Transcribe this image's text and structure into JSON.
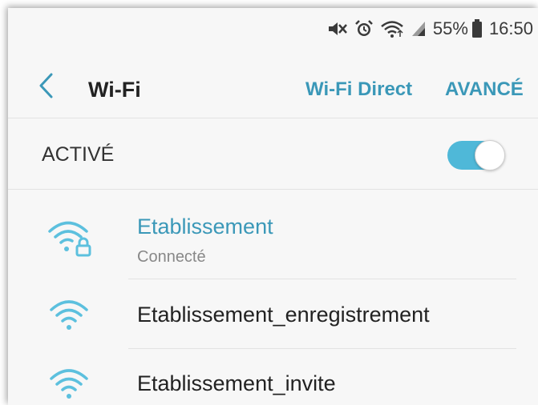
{
  "status_bar": {
    "icons": [
      "mute-vibrate-icon",
      "alarm-icon",
      "wifi-signal-icon",
      "cell-signal-icon",
      "battery-icon"
    ],
    "battery_percent": "55%",
    "time": "16:50"
  },
  "action_bar": {
    "back_icon": "chevron-left-icon",
    "title": "Wi-Fi",
    "wifi_direct_label": "Wi-Fi Direct",
    "advanced_label": "AVANCÉ"
  },
  "master_switch": {
    "label": "ACTIVÉ",
    "state": "on"
  },
  "networks": [
    {
      "name": "Etablissement",
      "status": "Connecté",
      "secured": true,
      "connected": true
    },
    {
      "name": "Etablissement_enregistrement",
      "status": "",
      "secured": false,
      "connected": false
    },
    {
      "name": "Etablissement_invite",
      "status": "",
      "secured": false,
      "connected": false
    }
  ],
  "colors": {
    "accent": "#3b98b8",
    "toggle_on": "#4fb8d8",
    "wifi_icon": "#5cc0de",
    "background": "#f7f7f7"
  }
}
